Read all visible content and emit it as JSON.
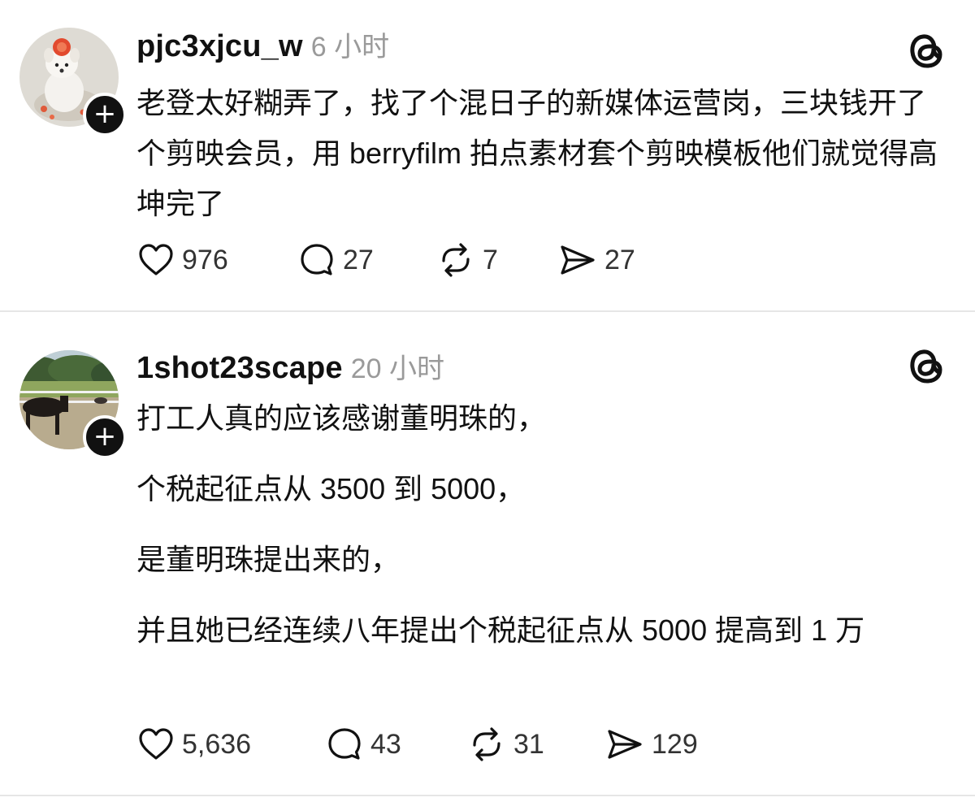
{
  "posts": [
    {
      "username": "pjc3xjcu_w",
      "time": "6 小时",
      "paragraphs": [
        "老登太好糊弄了，找了个混日子的新媒体运营岗，三块钱开了个剪映会员，用 berryfilm 拍点素材套个剪映模板他们就觉得高坤完了"
      ],
      "stats": {
        "likes": "976",
        "replies": "27",
        "reposts": "7",
        "shares": "27"
      }
    },
    {
      "username": "1shot23scape",
      "time": "20 小时",
      "paragraphs": [
        "打工人真的应该感谢董明珠的，",
        "个税起征点从 3500 到 5000，",
        "是董明珠提出来的，",
        "并且她已经连续八年提出个税起征点从 5000 提高到 1 万"
      ],
      "stats": {
        "likes": "5,636",
        "replies": "43",
        "reposts": "31",
        "shares": "129"
      }
    }
  ],
  "icons": {
    "like": "heart-icon",
    "reply": "comment-icon",
    "repost": "repost-icon",
    "share": "send-icon",
    "brand": "threads-logo-icon",
    "follow": "plus-icon"
  },
  "colors": {
    "text": "#111111",
    "muted": "#9a9a9a",
    "divider": "#e6e6e6"
  }
}
